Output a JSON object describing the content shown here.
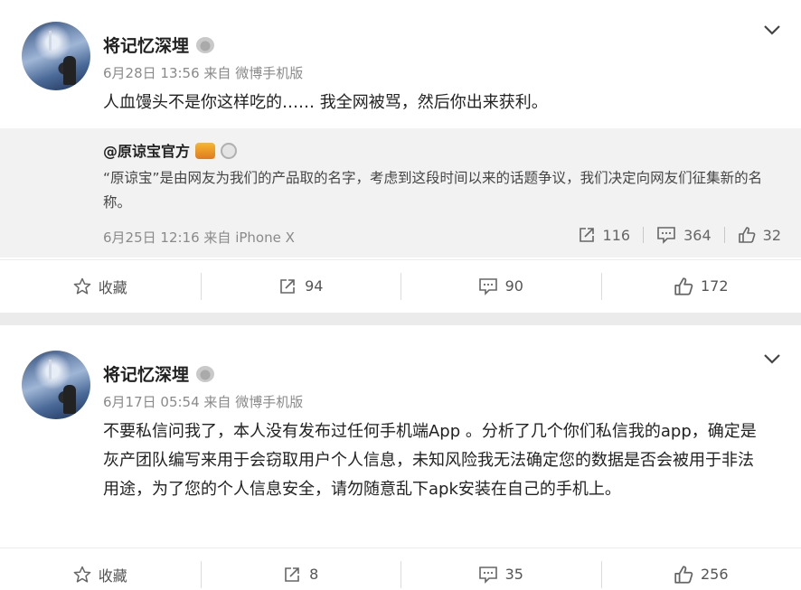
{
  "posts": [
    {
      "author": "将记忆深埋",
      "date": "6月28日 13:56",
      "source": "来自 微博手机版",
      "text": "人血馒头不是你这样吃的…… 我全网被骂，然后你出来获利。",
      "quoted": {
        "author": "@原谅宝官方",
        "text": "“原谅宝”是由网友为我们的产品取的名字，考虑到这段时间以来的话题争议，我们决定向网友们征集新的名称。",
        "date": "6月25日 12:16",
        "source": "来自 iPhone X",
        "reposts": "116",
        "comments": "364",
        "likes": "32"
      },
      "actions": {
        "favorite": "收藏",
        "reposts": "94",
        "comments": "90",
        "likes": "172"
      }
    },
    {
      "author": "将记忆深埋",
      "date": "6月17日 05:54",
      "source": "来自 微博手机版",
      "text": "不要私信问我了，本人没有发布过任何手机端App 。分析了几个你们私信我的app，确定是灰产团队编写来用于会窃取用户个人信息，未知风险我无法确定您的数据是否会被用于非法用途，为了您的个人信息安全，请勿随意乱下apk安装在自己的手机上。",
      "actions": {
        "favorite": "收藏",
        "reposts": "8",
        "comments": "35",
        "likes": "256"
      }
    }
  ],
  "icons": {
    "favorite": "star-icon",
    "repost": "share-arrow-icon",
    "comment": "comment-bubble-icon",
    "like": "thumbs-up-icon",
    "menu": "chevron-down-icon"
  }
}
